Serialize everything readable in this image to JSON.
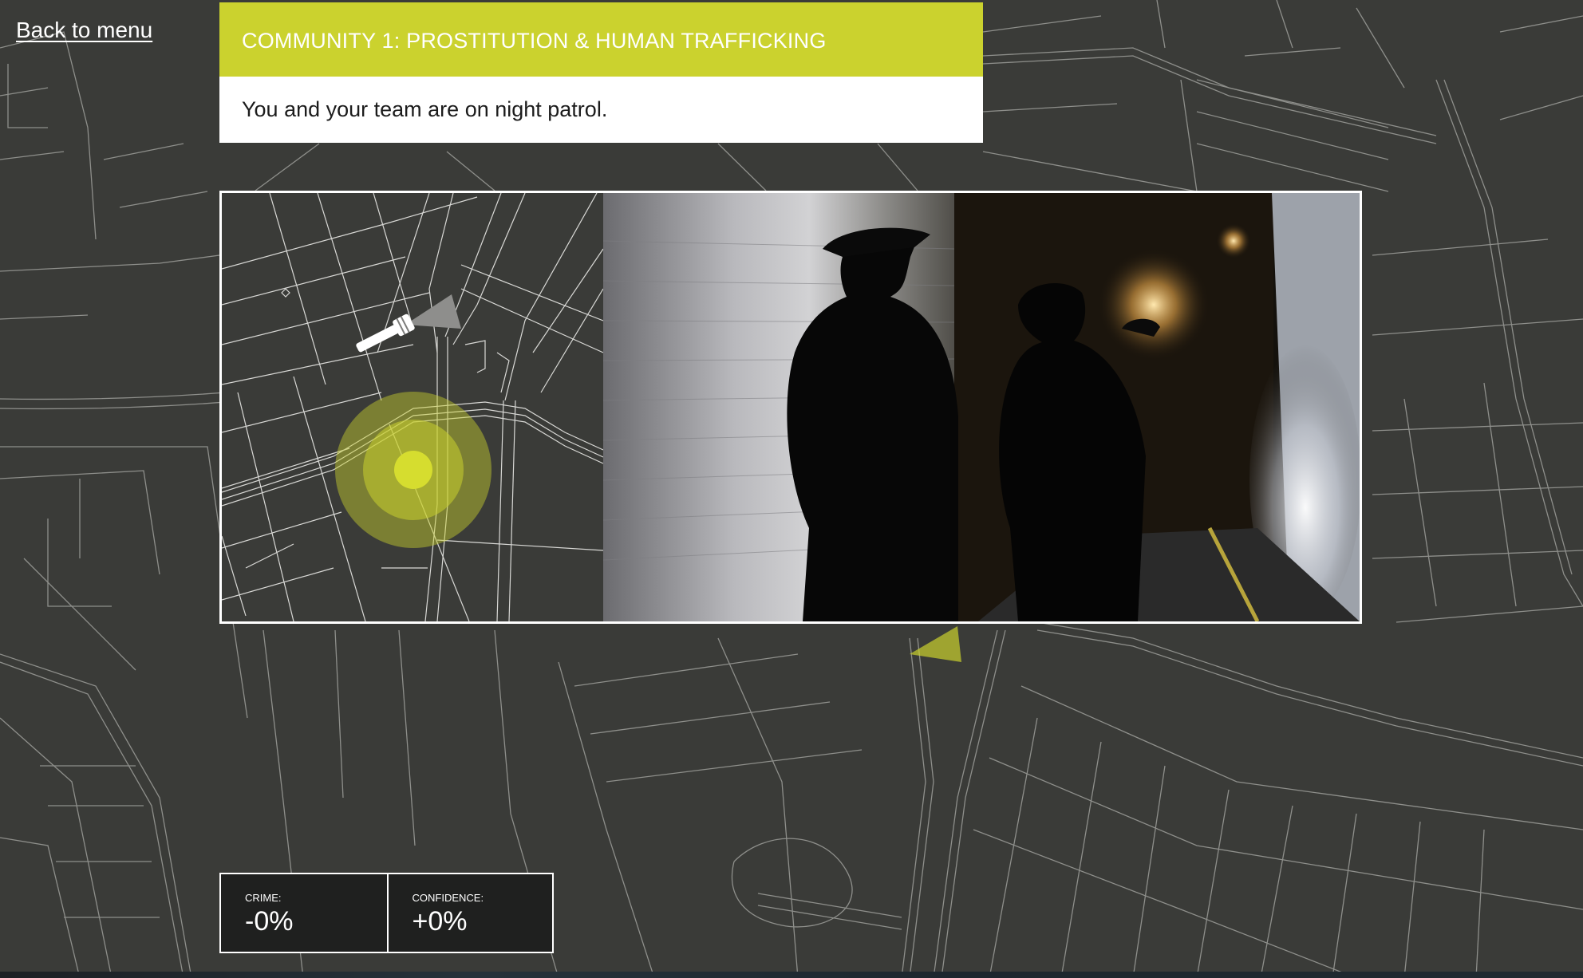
{
  "nav": {
    "back_label": "Back to menu"
  },
  "scenario": {
    "title": "COMMUNITY 1: PROSTITUTION & HUMAN TRAFFICKING",
    "text": "You and your team are on night patrol."
  },
  "stats": {
    "crime_label": "CRIME:",
    "crime_value": "-0%",
    "confidence_label": "CONFIDENCE:",
    "confidence_value": "+0%"
  },
  "icons": {
    "torch": "flashlight-icon",
    "location": "location-marker-icon"
  },
  "colors": {
    "accent": "#cbd22e",
    "background": "#3a3b38",
    "road_lines": "#8e8f8b",
    "panel_border": "#ffffff",
    "stats_background": "#1f201f"
  }
}
